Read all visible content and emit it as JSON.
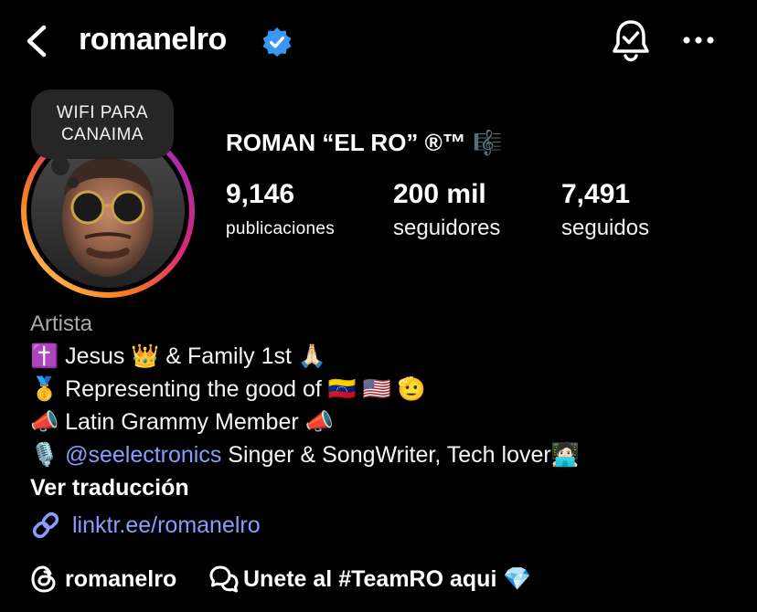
{
  "header": {
    "username": "romanelro",
    "verified_icon": "verified-badge-icon",
    "back_icon": "back-chevron-icon",
    "notifications_icon": "bell-check-icon",
    "menu_icon": "more-dots-icon"
  },
  "note": {
    "text_line1": "WIFI PARA",
    "text_line2": "CANAIMA"
  },
  "profile": {
    "display_name": "ROMAN “EL RO” ®™ 🎼",
    "stats": {
      "posts_value": "9,146",
      "posts_label": "publicaciones",
      "followers_value": "200 mil",
      "followers_label": "seguidores",
      "following_value": "7,491",
      "following_label": "seguidos"
    }
  },
  "bio": {
    "category": "Artista",
    "line1": "✝️ Jesus 👑 & Family 1st 🙏🏻",
    "line2": "🥇 Representing the good of 🇻🇪 🇺🇸 🫡",
    "line3": "📣 Latin Grammy Member  📣",
    "line4_prefix": "🎙️ ",
    "line4_mention": "@seelectronics",
    "line4_suffix": " Singer & SongWriter, Tech lover🧑🏻‍💻",
    "translate_label": "Ver traducción",
    "link_icon": "link-icon",
    "link_text": "linktr.ee/romanelro"
  },
  "footer": {
    "threads_icon": "threads-icon",
    "threads_username": "romanelro",
    "chat_icon": "chat-bubbles-icon",
    "channel_text": "Unete al #TeamRO aqui 💎"
  },
  "colors": {
    "background": "#000000",
    "link": "#8c9bff",
    "verified": "#3897f0",
    "category": "#a8a8a8"
  }
}
